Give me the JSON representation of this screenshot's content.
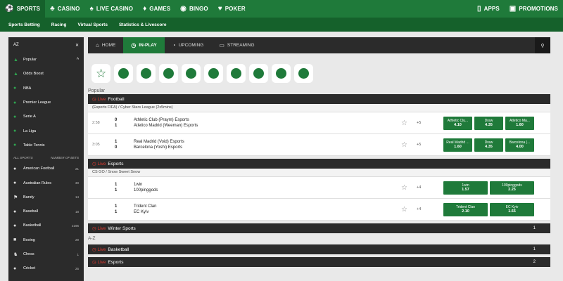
{
  "topnav": {
    "items": [
      {
        "label": "SPORTS",
        "icon": "sports-icon"
      },
      {
        "label": "CASINO",
        "icon": "casino-icon"
      },
      {
        "label": "LIVE CASINO",
        "icon": "live-casino-icon"
      },
      {
        "label": "GAMES",
        "icon": "games-icon"
      },
      {
        "label": "BINGO",
        "icon": "bingo-icon"
      },
      {
        "label": "POKER",
        "icon": "poker-icon"
      }
    ],
    "right": [
      {
        "label": "APPS",
        "icon": "phone-icon"
      },
      {
        "label": "PROMOTIONS",
        "icon": "gift-icon"
      }
    ]
  },
  "subnav": [
    "Sports Betting",
    "Racing",
    "Virtual Sports",
    "Statistics & Livescore"
  ],
  "sidebar": {
    "az": "AZ",
    "popular": "Popular",
    "popular_items": [
      "Odds Boost",
      "NBA",
      "Premier League",
      "Serie A",
      "La Liga",
      "Table Tennis"
    ],
    "all_sports": "ALL SPORTS",
    "number_of_bets": "NUMBER OF BETS",
    "sports": [
      {
        "name": "American Football",
        "count": "21"
      },
      {
        "name": "Australian Rules",
        "count": "30"
      },
      {
        "name": "Bandy",
        "count": "14"
      },
      {
        "name": "Baseball",
        "count": "18"
      },
      {
        "name": "Basketball",
        "count": "2196"
      },
      {
        "name": "Boxing",
        "count": "29"
      },
      {
        "name": "Chess",
        "count": "1"
      },
      {
        "name": "Cricket",
        "count": "25"
      }
    ]
  },
  "tabs": [
    "HOME",
    "IN-PLAY",
    "UPCOMING",
    "STREAMING"
  ],
  "section_popular": "Popular",
  "live_label": "Live",
  "football": {
    "title": "Football",
    "league": "(Esports FIFA) / Cyber Stars League (2x5mins)",
    "matches": [
      {
        "time": "2:58",
        "s1": "0",
        "s2": "1",
        "t1": "Athletic Club (Praym) Esports",
        "t2": "Atletico Madrid (Weeman) Esports",
        "more": "+5",
        "odds": [
          {
            "l": "Athletic Clu...",
            "v": "4.10"
          },
          {
            "l": "Draw",
            "v": "4.35"
          },
          {
            "l": "Atletico Ma...",
            "v": "1.60"
          }
        ]
      },
      {
        "time": "3:05",
        "s1": "1",
        "s2": "0",
        "t1": "Real Madrid (Void) Esports",
        "t2": "Barcelona (Yoshi) Esports",
        "more": "+5",
        "odds": [
          {
            "l": "Real Madrid ...",
            "v": "1.60"
          },
          {
            "l": "Draw",
            "v": "4.35"
          },
          {
            "l": "Barcelona (...",
            "v": "4.00"
          }
        ]
      }
    ]
  },
  "esports": {
    "title": "Esports",
    "league": "CS GO / Snow Sweet Snow",
    "matches": [
      {
        "s1": "1",
        "s2": "1",
        "t1": "1win",
        "t2": "100pinggods",
        "more": "+4",
        "odds": [
          {
            "l": "1win",
            "v": "1.57"
          },
          {
            "l": "100pinggods",
            "v": "2.25"
          }
        ]
      },
      {
        "s1": "1",
        "s2": "1",
        "t1": "Trident Clan",
        "t2": "EC Kyiv",
        "more": "+4",
        "odds": [
          {
            "l": "Trident Clan",
            "v": "2.10"
          },
          {
            "l": "EC Kyiv",
            "v": "1.65"
          }
        ]
      }
    ]
  },
  "winter": {
    "title": "Winter Sports",
    "count": "1"
  },
  "az_label": "A-Z",
  "basketball": {
    "title": "Basketball",
    "count": "1"
  },
  "esports2": {
    "title": "Esports",
    "count": "2"
  }
}
